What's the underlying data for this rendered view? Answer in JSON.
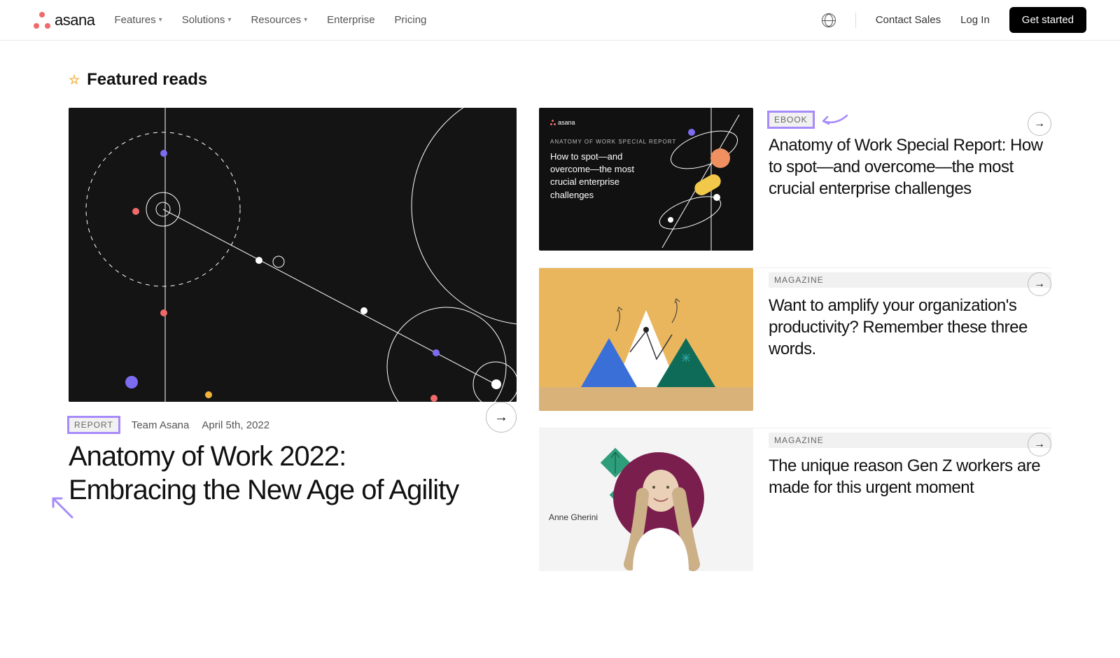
{
  "header": {
    "brand": "asana",
    "nav": [
      "Features",
      "Solutions",
      "Resources",
      "Enterprise",
      "Pricing"
    ],
    "nav_has_dropdown": [
      true,
      true,
      true,
      false,
      false
    ],
    "contact": "Contact Sales",
    "login": "Log In",
    "cta": "Get started"
  },
  "section_title": "Featured reads",
  "hero": {
    "tag": "REPORT",
    "author": "Team Asana",
    "date": "April 5th, 2022",
    "title": "Anatomy of Work 2022: Embracing the New Age of Agility"
  },
  "cards": [
    {
      "tag": "EBOOK",
      "tag_highlight": true,
      "title": "Anatomy of Work Special Report: How to spot—and overcome—the most crucial enterprise challenges",
      "thumb_kicker": "ANATOMY OF WORK SPECIAL REPORT",
      "thumb_title": "How to spot—and overcome—the most crucial enterprise challenges",
      "thumb_brand": "asana"
    },
    {
      "tag": "MAGAZINE",
      "tag_highlight": false,
      "title": "Want to amplify your organization's productivity? Remember these three words."
    },
    {
      "tag": "MAGAZINE",
      "tag_highlight": false,
      "title": "The unique reason Gen Z workers are made for this urgent moment",
      "thumb_person": "Anne Gherini"
    }
  ]
}
